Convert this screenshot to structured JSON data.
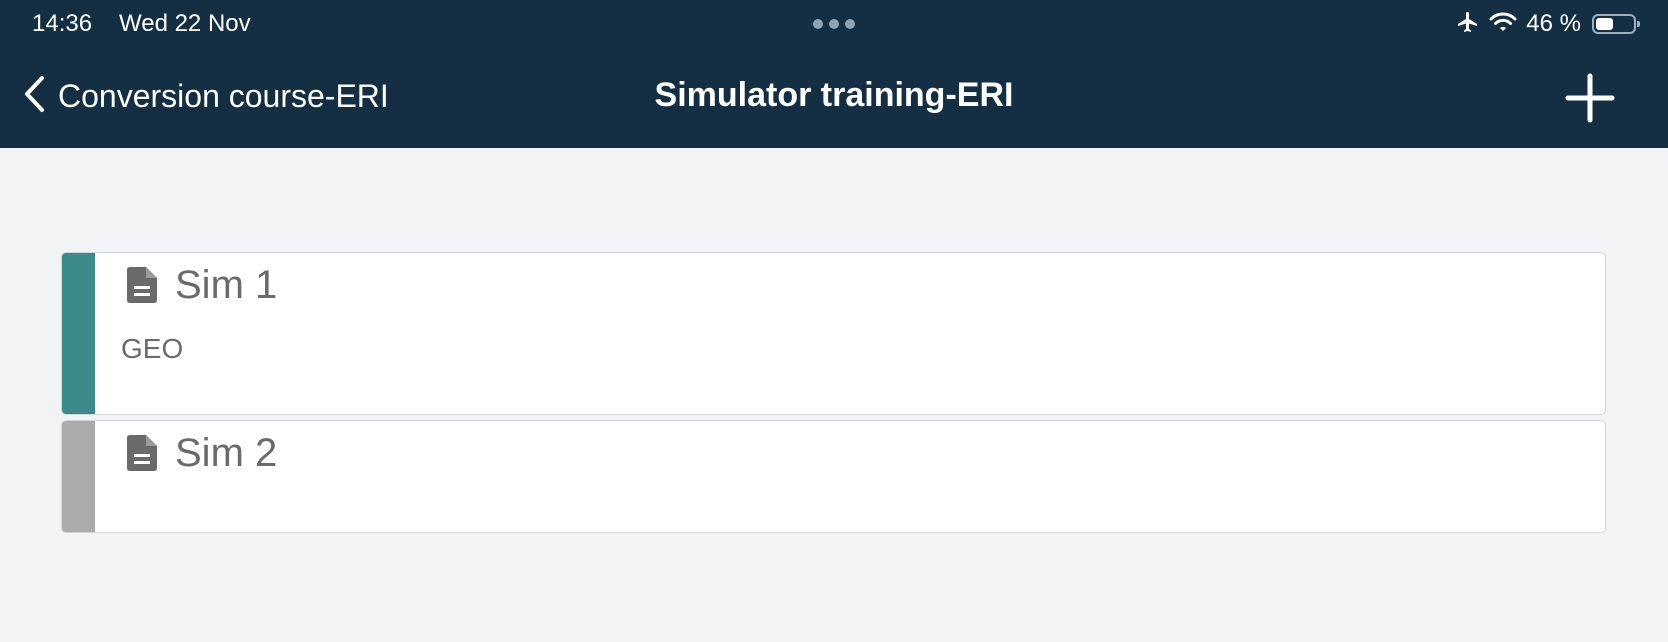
{
  "status_bar": {
    "time": "14:36",
    "date": "Wed 22 Nov",
    "battery_percent": "46 %",
    "battery_level": 0.46,
    "icons": [
      "airplane-icon",
      "wifi-icon",
      "battery-icon"
    ]
  },
  "nav": {
    "back_label": "Conversion course-ERI",
    "title": "Simulator training-ERI",
    "add_icon": "plus-icon"
  },
  "cards": [
    {
      "title": "Sim 1",
      "subtitle": "GEO",
      "accent": "#3b8b8a",
      "icon": "document-icon"
    },
    {
      "title": "Sim 2",
      "subtitle": "",
      "accent": "#ababab",
      "icon": "document-icon"
    }
  ],
  "colors": {
    "header_bg": "#142f43",
    "page_bg": "#f2f3f5",
    "card_text": "#6a6a6a"
  }
}
